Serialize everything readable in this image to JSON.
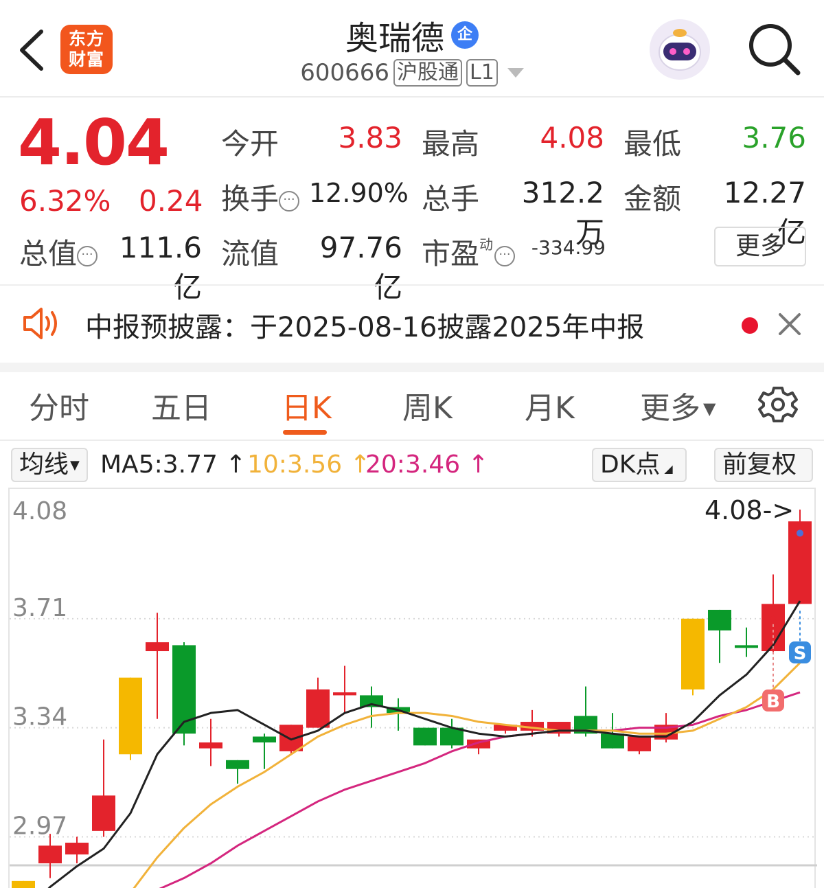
{
  "header": {
    "logo_line1": "东方",
    "logo_line2": "财富",
    "stock_name": "奥瑞德",
    "badge": "企",
    "code": "600666",
    "tag_connect": "沪股通",
    "tag_level": "L1"
  },
  "quote": {
    "price": "4.04",
    "change_pct": "6.32%",
    "change_amt": "0.24",
    "open_label": "今开",
    "open": "3.83",
    "high_label": "最高",
    "high": "4.08",
    "low_label": "最低",
    "low": "3.76",
    "turnover_label": "换手",
    "turnover": "12.90%",
    "volume_label": "总手",
    "volume": "312.2万",
    "amount_label": "金额",
    "amount": "12.27亿",
    "mktcap_label": "总值",
    "mktcap": "111.6亿",
    "float_label": "流值",
    "float_cap": "97.76亿",
    "pe_label": "市盈",
    "pe_sup": "动",
    "pe": "-334.99",
    "more_label": "更多"
  },
  "notice": {
    "text": "中报预披露：于2025-08-16披露2025年中报"
  },
  "tabs": [
    {
      "label": "分时"
    },
    {
      "label": "五日"
    },
    {
      "label": "日K"
    },
    {
      "label": "周K"
    },
    {
      "label": "月K"
    },
    {
      "label": "更多"
    }
  ],
  "ma_bar": {
    "select_label": "均线",
    "ma5": "MA5:3.77",
    "ma10": "10:3.56",
    "ma20": "20:3.46",
    "dk_label": "DK点",
    "adjust_label": "前复权"
  },
  "colors": {
    "up": "#e3232c",
    "down": "#0a9a2a",
    "accent": "#ef5b1c",
    "ma5": "#222222",
    "ma10": "#f1b23a",
    "ma20": "#d4267e",
    "yellow_candle": "#f5b800"
  },
  "chart_data": {
    "type": "candlestick",
    "y_ticks": [
      "4.08",
      "3.71",
      "3.34",
      "2.97"
    ],
    "ylim": [
      2.78,
      4.08
    ],
    "high_marker": "4.08",
    "signals": [
      {
        "label": "S"
      },
      {
        "label": "B"
      }
    ],
    "candles": [
      {
        "o": 2.82,
        "c": 2.76,
        "h": 2.82,
        "l": 2.7,
        "color": "yellow"
      },
      {
        "o": 2.88,
        "c": 2.94,
        "h": 2.98,
        "l": 2.83,
        "color": "red"
      },
      {
        "o": 2.91,
        "c": 2.95,
        "h": 2.97,
        "l": 2.88,
        "color": "red"
      },
      {
        "o": 2.99,
        "c": 3.11,
        "h": 3.3,
        "l": 2.97,
        "color": "red"
      },
      {
        "o": 3.25,
        "c": 3.51,
        "h": 3.51,
        "l": 3.23,
        "color": "yellow"
      },
      {
        "o": 3.6,
        "c": 3.63,
        "h": 3.73,
        "l": 3.37,
        "color": "red"
      },
      {
        "o": 3.62,
        "c": 3.32,
        "h": 3.63,
        "l": 3.28,
        "color": "green"
      },
      {
        "o": 3.27,
        "c": 3.29,
        "h": 3.37,
        "l": 3.21,
        "color": "red"
      },
      {
        "o": 3.23,
        "c": 3.2,
        "h": 3.23,
        "l": 3.15,
        "color": "green"
      },
      {
        "o": 3.31,
        "c": 3.29,
        "h": 3.32,
        "l": 3.2,
        "color": "green"
      },
      {
        "o": 3.26,
        "c": 3.35,
        "h": 3.35,
        "l": 3.25,
        "color": "red"
      },
      {
        "o": 3.34,
        "c": 3.47,
        "h": 3.51,
        "l": 3.34,
        "color": "red"
      },
      {
        "o": 3.45,
        "c": 3.46,
        "h": 3.55,
        "l": 3.39,
        "color": "red"
      },
      {
        "o": 3.45,
        "c": 3.41,
        "h": 3.48,
        "l": 3.34,
        "color": "green"
      },
      {
        "o": 3.41,
        "c": 3.39,
        "h": 3.44,
        "l": 3.33,
        "color": "green"
      },
      {
        "o": 3.34,
        "c": 3.28,
        "h": 3.34,
        "l": 3.28,
        "color": "green"
      },
      {
        "o": 3.34,
        "c": 3.28,
        "h": 3.37,
        "l": 3.27,
        "color": "green"
      },
      {
        "o": 3.27,
        "c": 3.3,
        "h": 3.3,
        "l": 3.25,
        "color": "red"
      },
      {
        "o": 3.33,
        "c": 3.35,
        "h": 3.35,
        "l": 3.32,
        "color": "red"
      },
      {
        "o": 3.33,
        "c": 3.36,
        "h": 3.4,
        "l": 3.31,
        "color": "red"
      },
      {
        "o": 3.36,
        "c": 3.32,
        "h": 3.36,
        "l": 3.31,
        "color": "red"
      },
      {
        "o": 3.38,
        "c": 3.32,
        "h": 3.48,
        "l": 3.31,
        "color": "green"
      },
      {
        "o": 3.32,
        "c": 3.27,
        "h": 3.39,
        "l": 3.27,
        "color": "green"
      },
      {
        "o": 3.31,
        "c": 3.26,
        "h": 3.31,
        "l": 3.25,
        "color": "red"
      },
      {
        "o": 3.3,
        "c": 3.35,
        "h": 3.39,
        "l": 3.29,
        "color": "red"
      },
      {
        "o": 3.47,
        "c": 3.71,
        "h": 3.71,
        "l": 3.45,
        "color": "yellow"
      },
      {
        "o": 3.74,
        "c": 3.67,
        "h": 3.74,
        "l": 3.56,
        "color": "green"
      },
      {
        "o": 3.62,
        "c": 3.62,
        "h": 3.68,
        "l": 3.58,
        "color": "green"
      },
      {
        "o": 3.6,
        "c": 3.76,
        "h": 3.86,
        "l": 3.59,
        "color": "red"
      },
      {
        "o": 3.76,
        "c": 4.04,
        "h": 4.08,
        "l": 3.76,
        "color": "red"
      }
    ],
    "ma5": [
      2.7,
      2.8,
      2.87,
      2.93,
      3.05,
      3.25,
      3.36,
      3.39,
      3.4,
      3.35,
      3.3,
      3.33,
      3.39,
      3.42,
      3.4,
      3.37,
      3.34,
      3.32,
      3.31,
      3.32,
      3.33,
      3.33,
      3.32,
      3.31,
      3.31,
      3.36,
      3.45,
      3.52,
      3.62,
      3.77
    ],
    "ma10": [
      null,
      null,
      null,
      null,
      2.78,
      2.9,
      3.0,
      3.08,
      3.14,
      3.19,
      3.25,
      3.31,
      3.35,
      3.38,
      3.39,
      3.39,
      3.38,
      3.36,
      3.35,
      3.34,
      3.33,
      3.33,
      3.33,
      3.32,
      3.32,
      3.33,
      3.37,
      3.41,
      3.47,
      3.56
    ],
    "ma20": [
      null,
      null,
      null,
      null,
      null,
      2.79,
      2.83,
      2.88,
      2.94,
      2.99,
      3.04,
      3.09,
      3.13,
      3.16,
      3.19,
      3.22,
      3.26,
      3.29,
      3.31,
      3.32,
      3.33,
      3.33,
      3.33,
      3.34,
      3.34,
      3.35,
      3.38,
      3.4,
      3.43,
      3.46
    ]
  }
}
